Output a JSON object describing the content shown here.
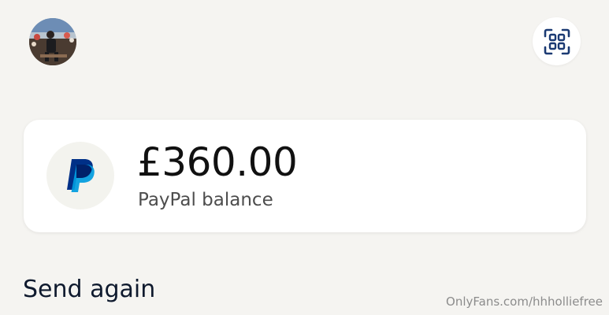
{
  "header": {
    "avatar_icon": "user-avatar-photo",
    "scan_icon": "qr-scan-icon"
  },
  "balance": {
    "amount": "£360.00",
    "label": "PayPal balance",
    "logo_icon": "paypal-logo-icon"
  },
  "send_again": {
    "title": "Send again"
  },
  "watermark": "OnlyFans.com/hhholliefree",
  "colors": {
    "background": "#f5f4f1",
    "card": "#ffffff",
    "paypal_dark_blue": "#003087",
    "paypal_light_blue": "#009cde",
    "scan_icon": "#1b3a73"
  }
}
